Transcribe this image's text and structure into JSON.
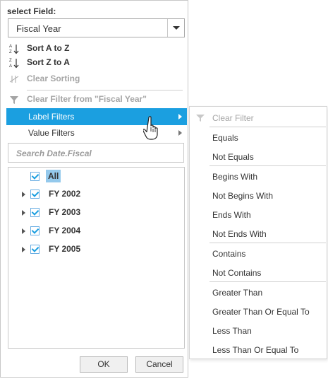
{
  "panel": {
    "field_title": "select Field:",
    "field_value": "Fiscal Year",
    "sort_az": "Sort A to Z",
    "sort_za": "Sort Z to A",
    "clear_sorting": "Clear Sorting",
    "clear_filter": "Clear Filter from \"Fiscal Year\"",
    "label_filters": "Label Filters",
    "value_filters": "Value Filters",
    "search_placeholder": "Search Date.Fiscal",
    "tree": {
      "all": "All",
      "items": [
        "FY 2002",
        "FY 2003",
        "FY 2004",
        "FY 2005"
      ]
    },
    "ok": "OK",
    "cancel": "Cancel"
  },
  "submenu": {
    "clear_filter": "Clear Filter",
    "items": [
      "Equals",
      "Not Equals",
      "Begins With",
      "Not Begins With",
      "Ends With",
      "Not Ends With",
      "Contains",
      "Not Contains",
      "Greater Than",
      "Greater Than Or Equal To",
      "Less Than",
      "Less Than Or Equal To"
    ]
  },
  "colors": {
    "accent": "#1b9fe0",
    "all_highlight": "#94c9ec",
    "disabled": "#a5a5a5"
  },
  "icons": {
    "sort_az": "sort-a-z-icon",
    "sort_za": "sort-z-a-icon",
    "clear_sorting": "clear-sort-icon",
    "clear_filter": "filter-icon",
    "cursor": "hand-pointer-icon"
  }
}
